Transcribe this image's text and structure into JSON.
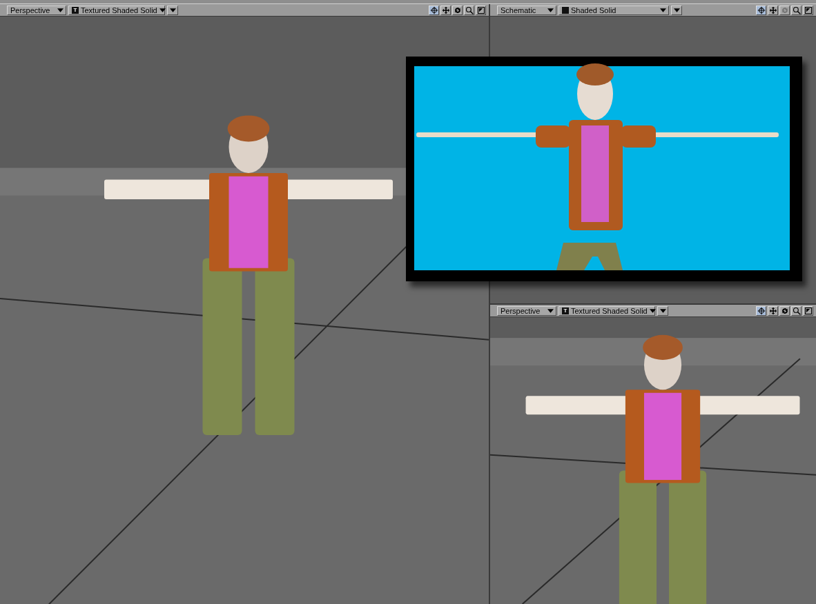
{
  "viewports": [
    {
      "view": "Perspective",
      "shading": "Textured Shaded Solid",
      "shading_badge": "T",
      "tools": [
        {
          "kind": "move-view",
          "selected": true,
          "disabled": false
        },
        {
          "kind": "pan",
          "selected": false,
          "disabled": false
        },
        {
          "kind": "rotate",
          "selected": false,
          "disabled": false
        },
        {
          "kind": "zoom",
          "selected": false,
          "disabled": false
        },
        {
          "kind": "maximize",
          "selected": false,
          "disabled": false
        }
      ]
    },
    {
      "view": "Schematic",
      "shading": "Shaded Solid",
      "tools": [
        {
          "kind": "move-view",
          "selected": true,
          "disabled": false
        },
        {
          "kind": "pan",
          "selected": false,
          "disabled": false
        },
        {
          "kind": "rotate",
          "selected": false,
          "disabled": true
        },
        {
          "kind": "zoom",
          "selected": false,
          "disabled": false
        },
        {
          "kind": "maximize",
          "selected": false,
          "disabled": false
        }
      ],
      "content": {
        "kind": "empty"
      }
    },
    {
      "view": "Perspective",
      "shading": "Textured Shaded Solid",
      "shading_badge": "T",
      "tools": [
        {
          "kind": "move-view",
          "selected": true,
          "disabled": false
        },
        {
          "kind": "pan",
          "selected": false,
          "disabled": false
        },
        {
          "kind": "rotate",
          "selected": false,
          "disabled": false
        },
        {
          "kind": "zoom",
          "selected": false,
          "disabled": false
        },
        {
          "kind": "maximize",
          "selected": false,
          "disabled": false
        }
      ]
    }
  ]
}
